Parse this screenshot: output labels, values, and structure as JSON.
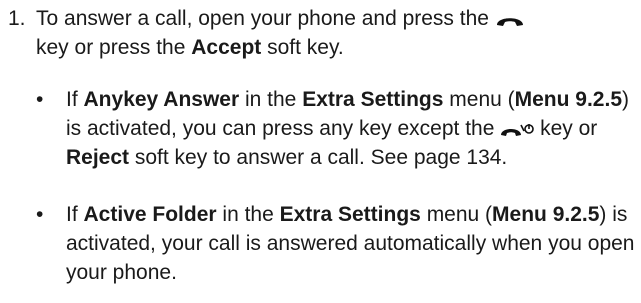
{
  "step": {
    "number": "1.",
    "text_1": "To answer a call, open your phone and press the",
    "text_2": "key or press the",
    "accept_label": "Accept",
    "text_3": "soft key."
  },
  "bullets": [
    {
      "marker": "•",
      "t1": "If",
      "anykey": "Anykey Answer",
      "t2": "in the",
      "extra": "Extra Settings",
      "t3": "menu (",
      "menu": "Menu 9.2.5",
      "t4": ") is activated, you can press any key except the",
      "t5": "key or",
      "reject": "Reject",
      "t6": "soft key to answer a call. See page 134."
    },
    {
      "marker": "•",
      "t1": "If",
      "active": "Active Folder",
      "t2": "in the",
      "extra": "Extra Settings",
      "t3": "menu (",
      "menu": "Menu 9.2.5",
      "t4": ") is activated, your call is answered automatically when you open your phone."
    }
  ],
  "icons": {
    "send_key": "call-send-key-icon",
    "end_key": "call-end-power-key-icon"
  }
}
